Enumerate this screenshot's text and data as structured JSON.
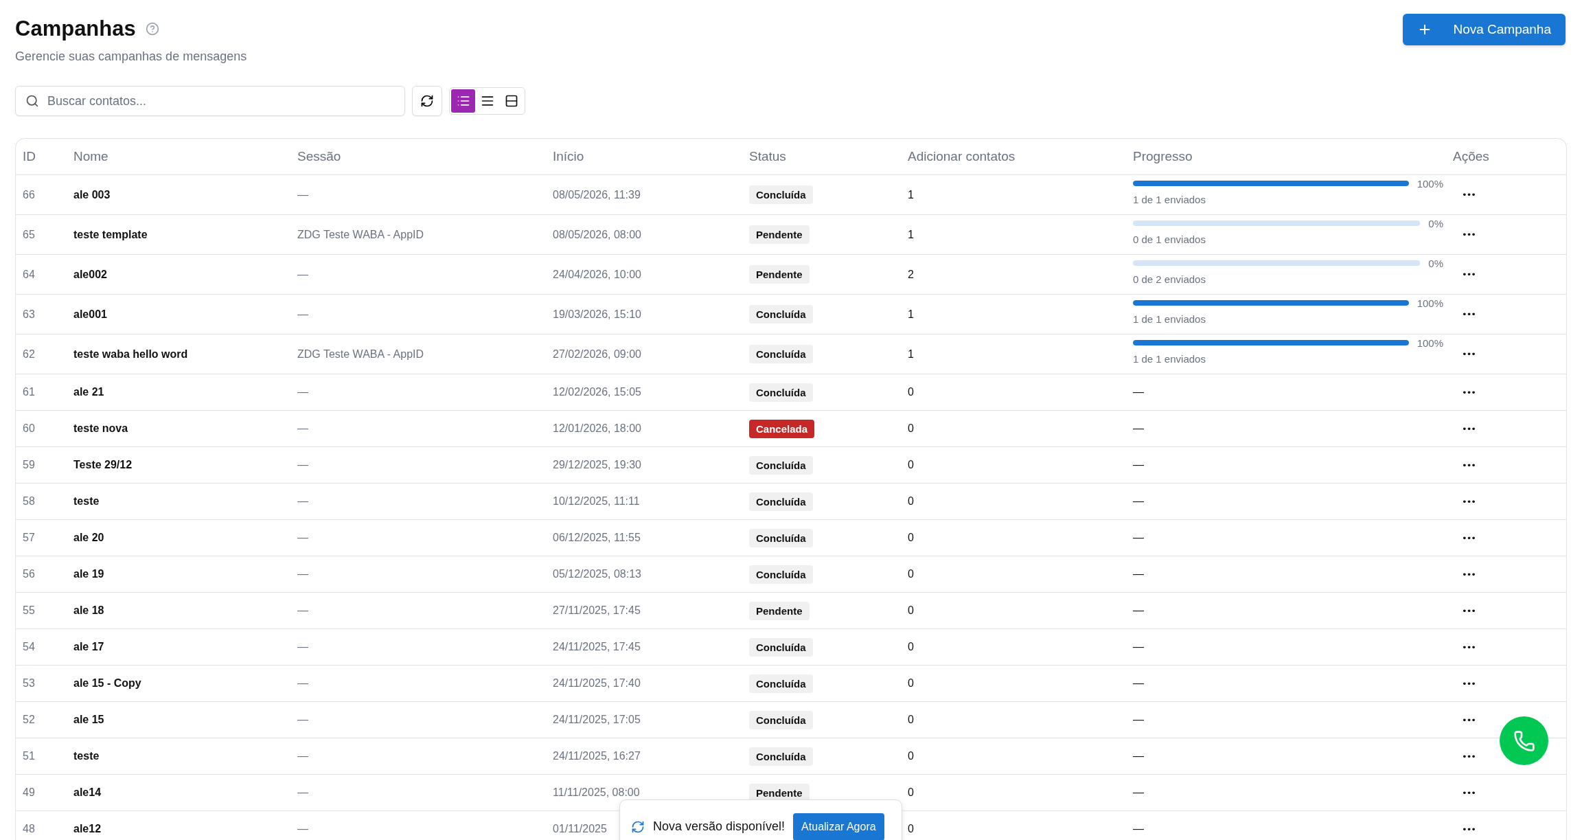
{
  "header": {
    "title": "Campanhas",
    "subtitle": "Gerencie suas campanhas de mensagens",
    "new_button": "Nova Campanha"
  },
  "toolbar": {
    "search_placeholder": "Buscar contatos...",
    "view_modes": [
      {
        "selected": true
      },
      {
        "selected": false
      },
      {
        "selected": false
      }
    ]
  },
  "table": {
    "columns": [
      "ID",
      "Nome",
      "Sessão",
      "Início",
      "Status",
      "Adicionar contatos",
      "Progresso",
      "Ações"
    ],
    "rows": [
      {
        "id": "66",
        "name": "ale 003",
        "session": "—",
        "start": "08/05/2026, 11:39",
        "status": {
          "label": "Concluída",
          "kind": "neutral"
        },
        "contacts": "1",
        "progress": {
          "level": 1,
          "percent": "100%",
          "sent": "1 de 1 enviados"
        },
        "actions": "•••"
      },
      {
        "id": "65",
        "name": "teste template",
        "session": "ZDG Teste WABA - AppID",
        "start": "08/05/2026, 08:00",
        "status": {
          "label": "Pendente",
          "kind": "neutral"
        },
        "contacts": "1",
        "progress": {
          "level": 0,
          "percent": "0%",
          "sent": "0 de 1 enviados"
        },
        "actions": "•••"
      },
      {
        "id": "64",
        "name": "ale002",
        "session": "—",
        "start": "24/04/2026, 10:00",
        "status": {
          "label": "Pendente",
          "kind": "neutral"
        },
        "contacts": "2",
        "progress": {
          "level": 0,
          "percent": "0%",
          "sent": "0 de 2 enviados"
        },
        "actions": "•••"
      },
      {
        "id": "63",
        "name": "ale001",
        "session": "—",
        "start": "19/03/2026, 15:10",
        "status": {
          "label": "Concluída",
          "kind": "neutral"
        },
        "contacts": "1",
        "progress": {
          "level": 1,
          "percent": "100%",
          "sent": "1 de 1 enviados"
        },
        "actions": "•••"
      },
      {
        "id": "62",
        "name": "teste waba hello word",
        "session": "ZDG Teste WABA - AppID",
        "start": "27/02/2026, 09:00",
        "status": {
          "label": "Concluída",
          "kind": "neutral"
        },
        "contacts": "1",
        "progress": {
          "level": 1,
          "percent": "100%",
          "sent": "1 de 1 enviados"
        },
        "actions": "•••"
      },
      {
        "id": "61",
        "name": "ale 21",
        "session": "—",
        "start": "12/02/2026, 15:05",
        "status": {
          "label": "Concluída",
          "kind": "neutral"
        },
        "contacts": "0",
        "no_progress": "—",
        "actions": "•••"
      },
      {
        "id": "60",
        "name": "teste nova",
        "session": "—",
        "start": "12/01/2026, 18:00",
        "status": {
          "label": "Cancelada",
          "kind": "danger"
        },
        "contacts": "0",
        "no_progress": "—",
        "actions": "•••"
      },
      {
        "id": "59",
        "name": "Teste 29/12",
        "session": "—",
        "start": "29/12/2025, 19:30",
        "status": {
          "label": "Concluída",
          "kind": "neutral"
        },
        "contacts": "0",
        "no_progress": "—",
        "actions": "•••"
      },
      {
        "id": "58",
        "name": "teste",
        "session": "—",
        "start": "10/12/2025, 11:11",
        "status": {
          "label": "Concluída",
          "kind": "neutral"
        },
        "contacts": "0",
        "no_progress": "—",
        "actions": "•••"
      },
      {
        "id": "57",
        "name": "ale 20",
        "session": "—",
        "start": "06/12/2025, 11:55",
        "status": {
          "label": "Concluída",
          "kind": "neutral"
        },
        "contacts": "0",
        "no_progress": "—",
        "actions": "•••"
      },
      {
        "id": "56",
        "name": "ale 19",
        "session": "—",
        "start": "05/12/2025, 08:13",
        "status": {
          "label": "Concluída",
          "kind": "neutral"
        },
        "contacts": "0",
        "no_progress": "—",
        "actions": "•••"
      },
      {
        "id": "55",
        "name": "ale 18",
        "session": "—",
        "start": "27/11/2025, 17:45",
        "status": {
          "label": "Pendente",
          "kind": "neutral"
        },
        "contacts": "0",
        "no_progress": "—",
        "actions": "•••"
      },
      {
        "id": "54",
        "name": "ale 17",
        "session": "—",
        "start": "24/11/2025, 17:45",
        "status": {
          "label": "Concluída",
          "kind": "neutral"
        },
        "contacts": "0",
        "no_progress": "—",
        "actions": "•••"
      },
      {
        "id": "53",
        "name": "ale 15 - Copy",
        "session": "—",
        "start": "24/11/2025, 17:40",
        "status": {
          "label": "Concluída",
          "kind": "neutral"
        },
        "contacts": "0",
        "no_progress": "—",
        "actions": "•••"
      },
      {
        "id": "52",
        "name": "ale 15",
        "session": "—",
        "start": "24/11/2025, 17:05",
        "status": {
          "label": "Concluída",
          "kind": "neutral"
        },
        "contacts": "0",
        "no_progress": "—",
        "actions": "•••"
      },
      {
        "id": "51",
        "name": "teste",
        "session": "—",
        "start": "24/11/2025, 16:27",
        "status": {
          "label": "Concluída",
          "kind": "neutral"
        },
        "contacts": "0",
        "no_progress": "—",
        "actions": "•••"
      },
      {
        "id": "49",
        "name": "ale14",
        "session": "—",
        "start": "11/11/2025, 08:00",
        "status": {
          "label": "Pendente",
          "kind": "neutral"
        },
        "contacts": "0",
        "no_progress": "—",
        "actions": "•••"
      },
      {
        "id": "48",
        "name": "ale12",
        "session": "—",
        "start": "01/11/2025",
        "contacts": "0",
        "no_progress": "—",
        "actions": "•••"
      }
    ]
  },
  "toast": {
    "message": "Nova versão disponível!",
    "button": "Atualizar Agora"
  }
}
